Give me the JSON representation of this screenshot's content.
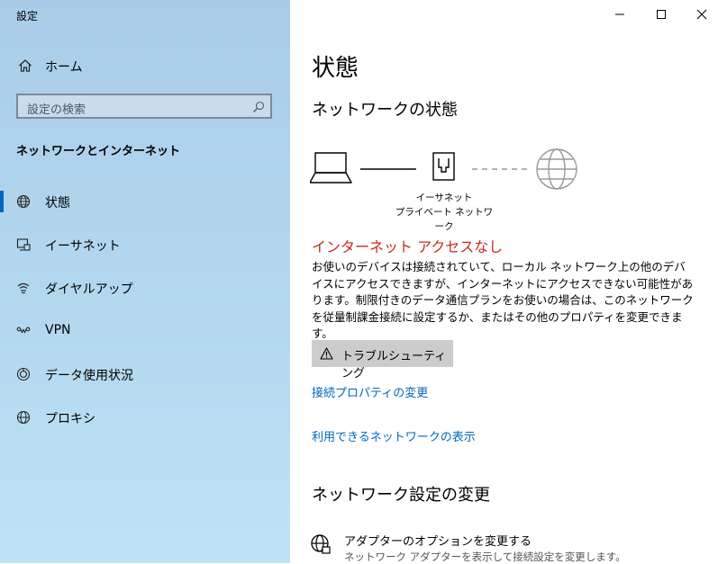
{
  "window": {
    "title": "設定",
    "controls": {
      "minimize": "minimize-icon",
      "maximize": "maximize-icon",
      "close": "close-icon"
    }
  },
  "sidebar": {
    "home_label": "ホーム",
    "search_placeholder": "設定の検索",
    "section_title": "ネットワークとインターネット",
    "items": [
      {
        "label": "状態",
        "icon": "globe-icon",
        "selected": true
      },
      {
        "label": "イーサネット",
        "icon": "ethernet-icon",
        "selected": false
      },
      {
        "label": "ダイヤルアップ",
        "icon": "dialup-icon",
        "selected": false
      },
      {
        "label": "VPN",
        "icon": "vpn-icon",
        "selected": false
      },
      {
        "label": "データ使用状況",
        "icon": "data-usage-icon",
        "selected": false
      },
      {
        "label": "プロキシ",
        "icon": "proxy-icon",
        "selected": false
      }
    ]
  },
  "main": {
    "page_title": "状態",
    "network_status_heading": "ネットワークの状態",
    "diagram": {
      "adapter_line1": "イーサネット",
      "adapter_line2": "プライベート ネットワーク"
    },
    "status_title": "インターネット アクセスなし",
    "status_desc": "お使いのデバイスは接続されていて、ローカル ネットワーク上の他のデバイスにアクセスできますが、インターネットにアクセスできない可能性があります。制限付きのデータ通信プランをお使いの場合は、このネットワークを従量制課金接続に設定するか、またはその他のプロパティを変更できます。",
    "troubleshoot_label": "トラブルシューティング",
    "link_connection_props": "接続プロパティの変更",
    "link_show_networks": "利用できるネットワークの表示",
    "change_settings_heading": "ネットワーク設定の変更",
    "adapter_option_title": "アダプターのオプションを変更する",
    "adapter_option_desc": "ネットワーク アダプターを表示して接続設定を変更します。"
  },
  "colors": {
    "accent": "#0067c0",
    "warning": "#c42b1c",
    "sidebar_bg": "#b0d5ed"
  }
}
